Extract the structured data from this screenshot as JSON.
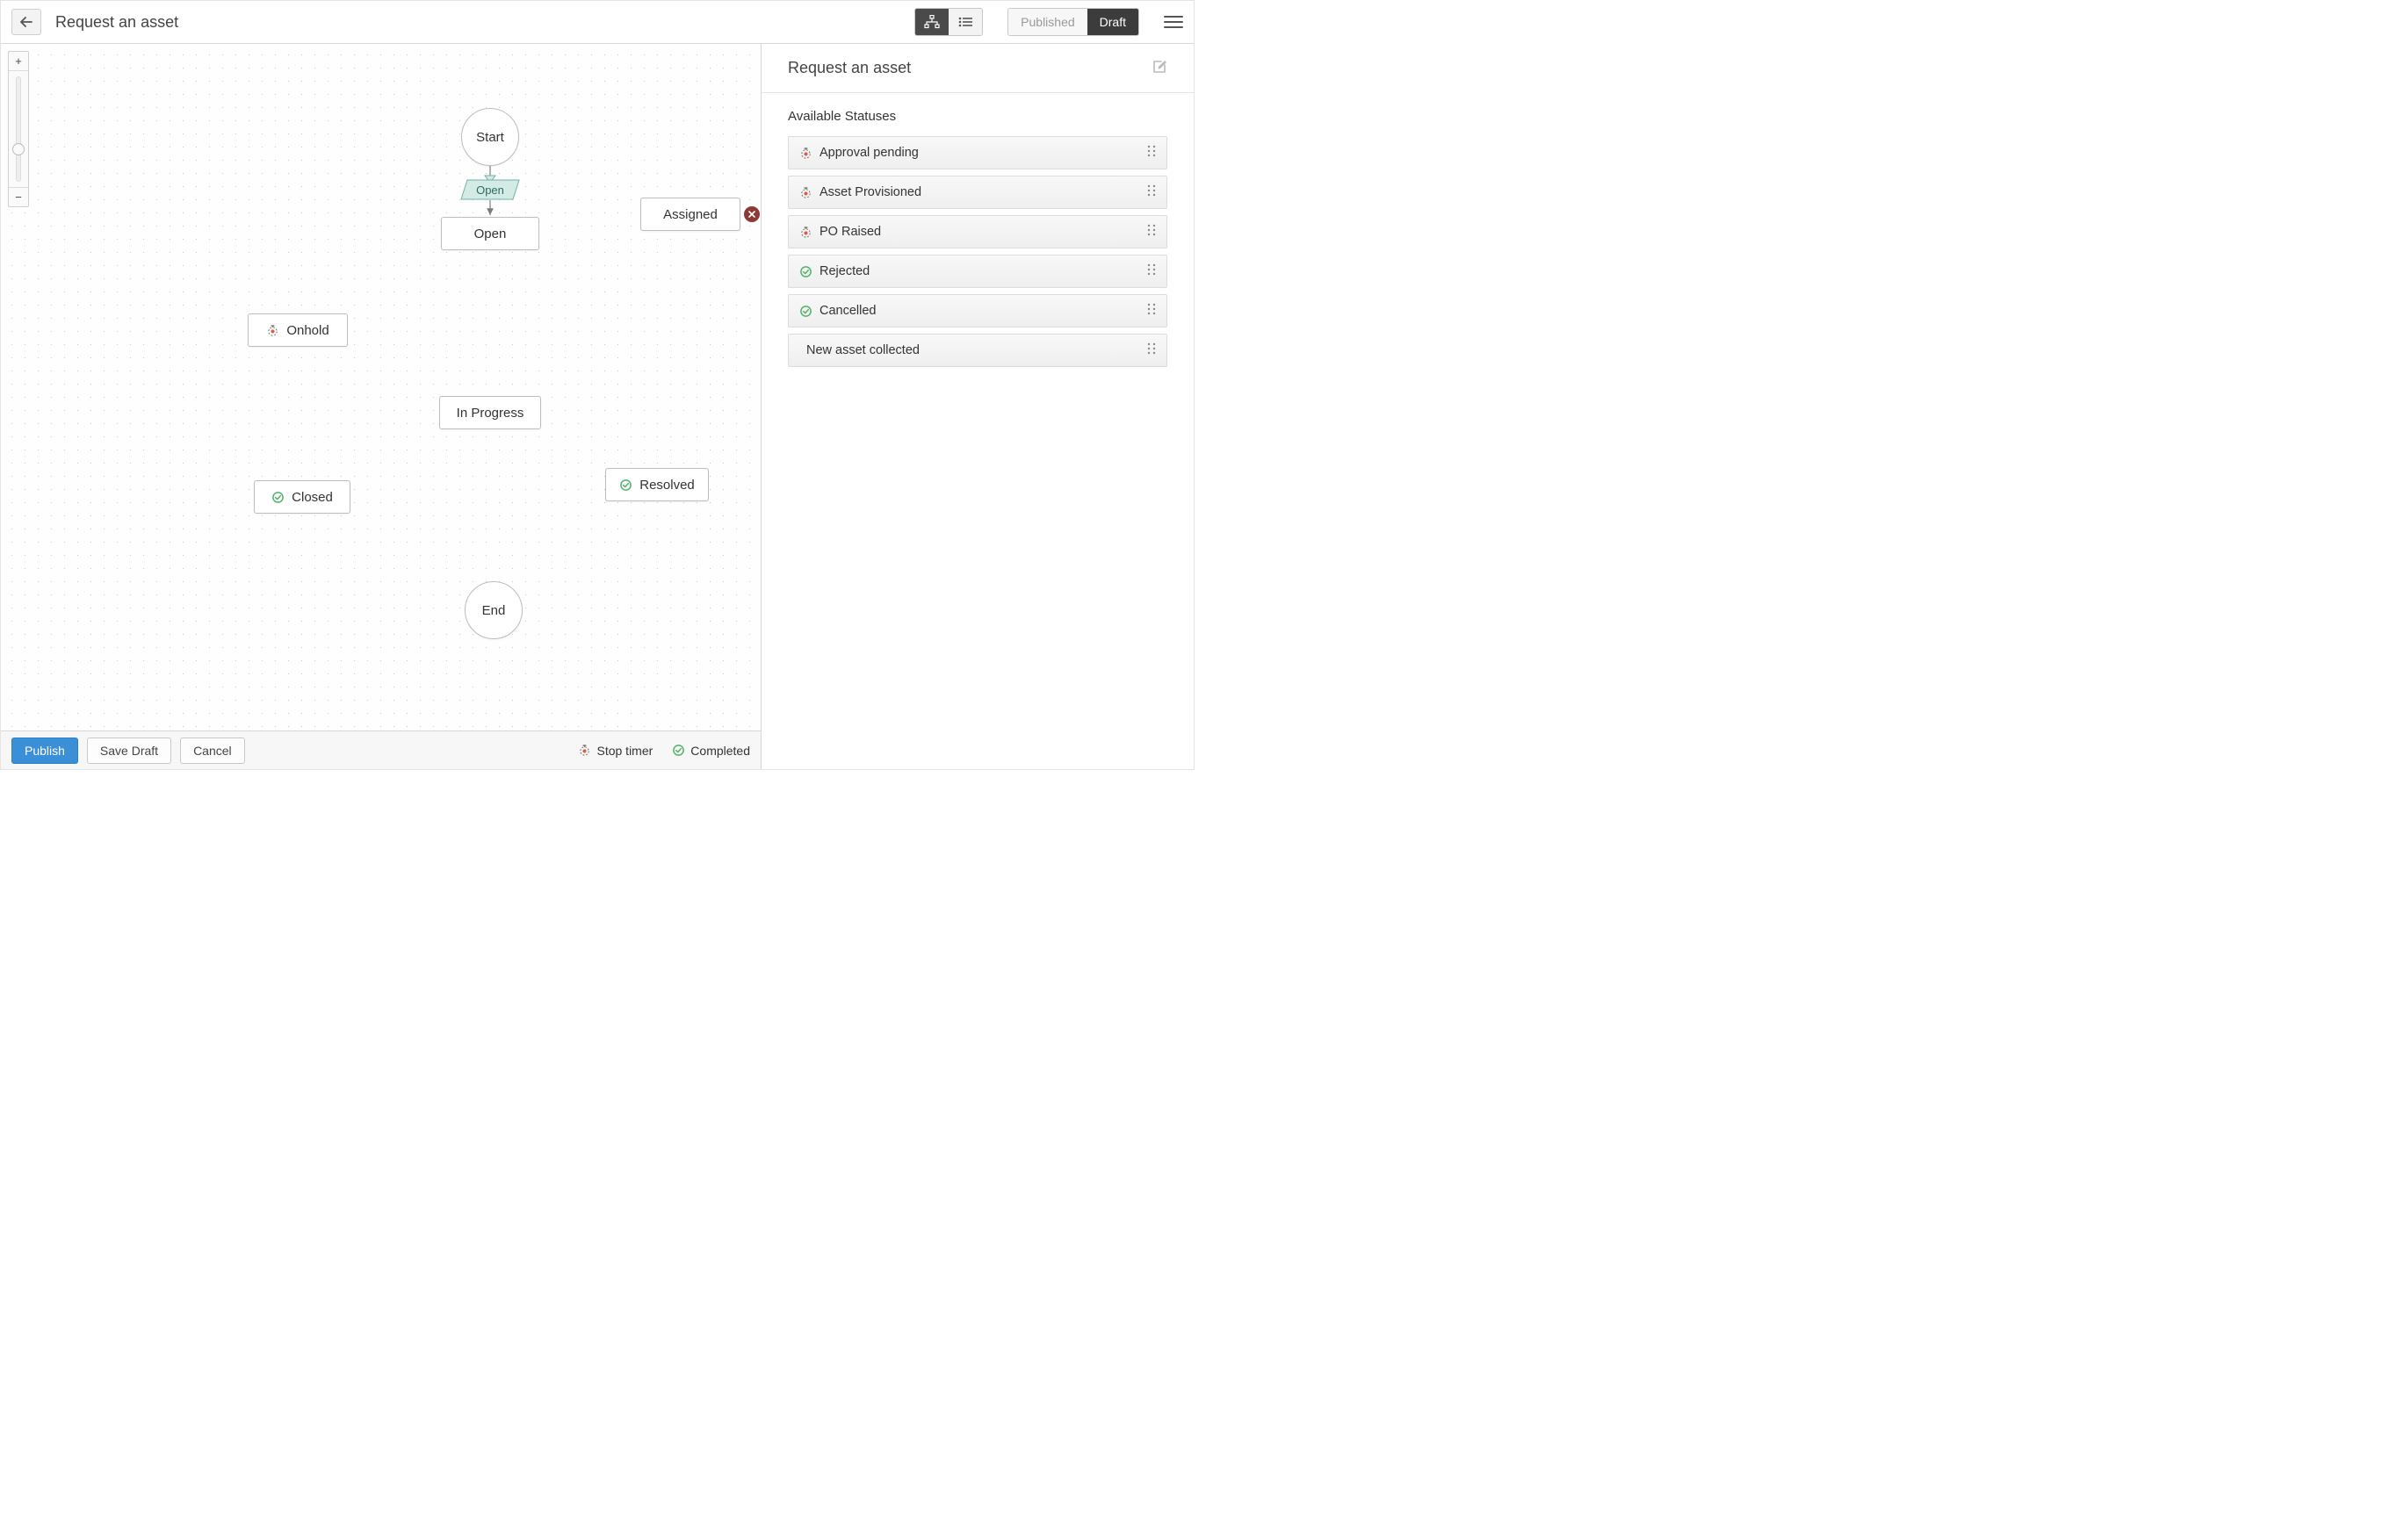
{
  "header": {
    "title": "Request an asset",
    "view_toggle": {
      "active": "flow"
    },
    "publish_toggle": {
      "published_label": "Published",
      "draft_label": "Draft",
      "active": "draft"
    }
  },
  "canvas": {
    "nodes": {
      "start": {
        "label": "Start"
      },
      "open_transition": {
        "label": "Open"
      },
      "open": {
        "label": "Open"
      },
      "assigned": {
        "label": "Assigned"
      },
      "onhold": {
        "label": "Onhold",
        "icon": "stop-timer"
      },
      "in_progress": {
        "label": "In Progress"
      },
      "resolved": {
        "label": "Resolved",
        "icon": "completed"
      },
      "closed": {
        "label": "Closed",
        "icon": "completed"
      },
      "end": {
        "label": "End"
      }
    }
  },
  "side": {
    "title": "Request an asset",
    "section_label": "Available Statuses",
    "statuses": [
      {
        "label": "Approval pending",
        "icon": "stop-timer"
      },
      {
        "label": "Asset Provisioned",
        "icon": "stop-timer"
      },
      {
        "label": "PO Raised",
        "icon": "stop-timer"
      },
      {
        "label": "Rejected",
        "icon": "completed"
      },
      {
        "label": "Cancelled",
        "icon": "completed"
      },
      {
        "label": "New asset collected",
        "icon": "none"
      }
    ]
  },
  "footer": {
    "publish_label": "Publish",
    "save_draft_label": "Save Draft",
    "cancel_label": "Cancel",
    "legend": {
      "stop_timer_label": "Stop timer",
      "completed_label": "Completed"
    }
  }
}
